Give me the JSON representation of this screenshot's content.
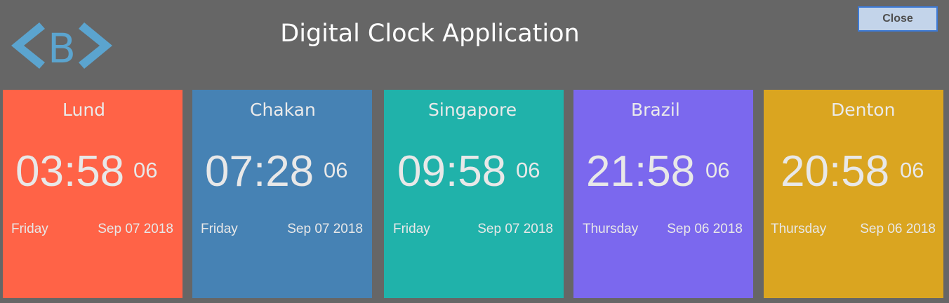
{
  "header": {
    "title": "Digital Clock Application",
    "close_label": "Close",
    "logo_letter": "B"
  },
  "colors": {
    "background": "#666666",
    "logo_blue": "#5ba4cf",
    "close_button_fill": "#c3d4ea",
    "close_button_border": "#3d7ad6"
  },
  "clocks": [
    {
      "city": "Lund",
      "time": "03:58",
      "seconds": "06",
      "day": "Friday",
      "date": "Sep 07 2018",
      "color": "#ff6347"
    },
    {
      "city": "Chakan",
      "time": "07:28",
      "seconds": "06",
      "day": "Friday",
      "date": "Sep 07 2018",
      "color": "#4682b4"
    },
    {
      "city": "Singapore",
      "time": "09:58",
      "seconds": "06",
      "day": "Friday",
      "date": "Sep 07 2018",
      "color": "#20b2aa"
    },
    {
      "city": "Brazil",
      "time": "21:58",
      "seconds": "06",
      "day": "Thursday",
      "date": "Sep 06 2018",
      "color": "#7b68ee"
    },
    {
      "city": "Denton",
      "time": "20:58",
      "seconds": "06",
      "day": "Thursday",
      "date": "Sep 06 2018",
      "color": "#daa520"
    }
  ]
}
